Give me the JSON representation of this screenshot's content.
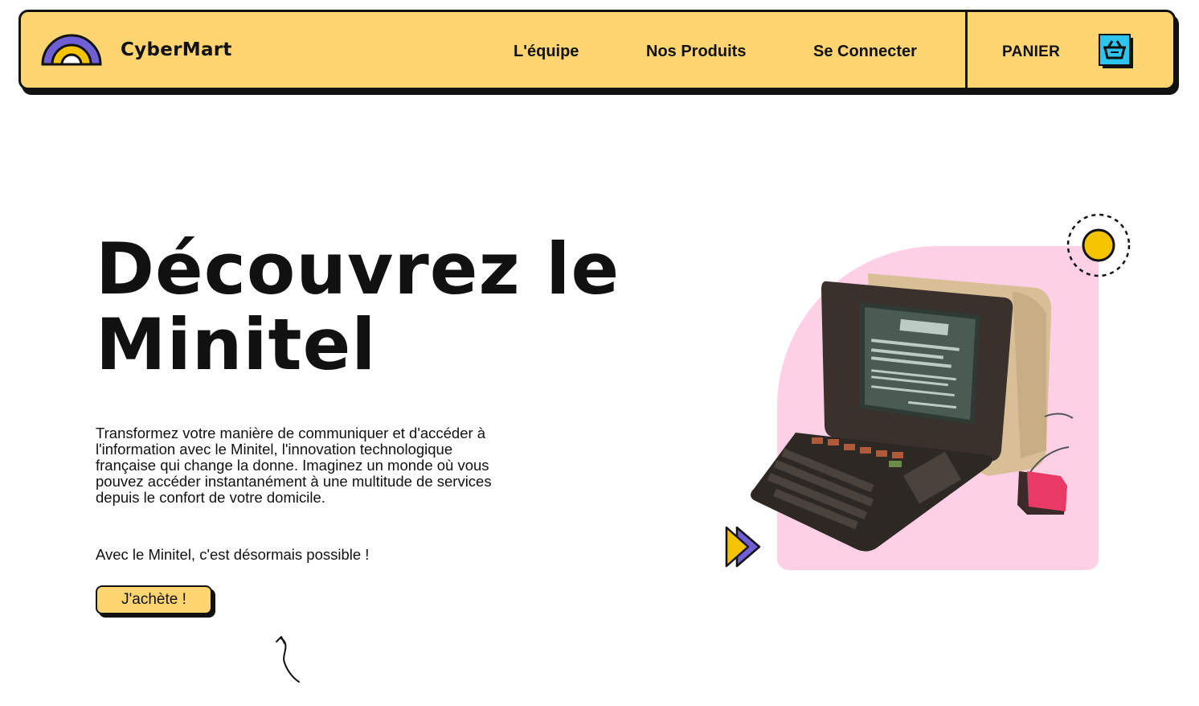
{
  "header": {
    "brand": "CyberMart",
    "nav": [
      {
        "label": "L'équipe"
      },
      {
        "label": "Nos Produits"
      },
      {
        "label": "Se Connecter"
      }
    ],
    "cart_label": "PANIER",
    "logo_icon": "rainbow-icon",
    "cart_icon": "shopping-basket-icon"
  },
  "hero": {
    "title_line1": "Découvrez le",
    "title_line2": "Minitel",
    "description": "Transformez votre manière de communiquer et d'accéder à l'information avec le Minitel, l'innovation technologique française qui change la donne. Imaginez un monde où vous pouvez accéder instantanément à une multitude de services depuis le confort de votre domicile.",
    "tagline": "Avec le Minitel, c'est désormais possible !",
    "button_label": "J'achète !"
  },
  "colors": {
    "accent": "#ffd572",
    "pink": "#fdd0e6",
    "purple": "#6e5fd4",
    "yellow": "#f5c400",
    "cyan": "#2ec4f0"
  }
}
